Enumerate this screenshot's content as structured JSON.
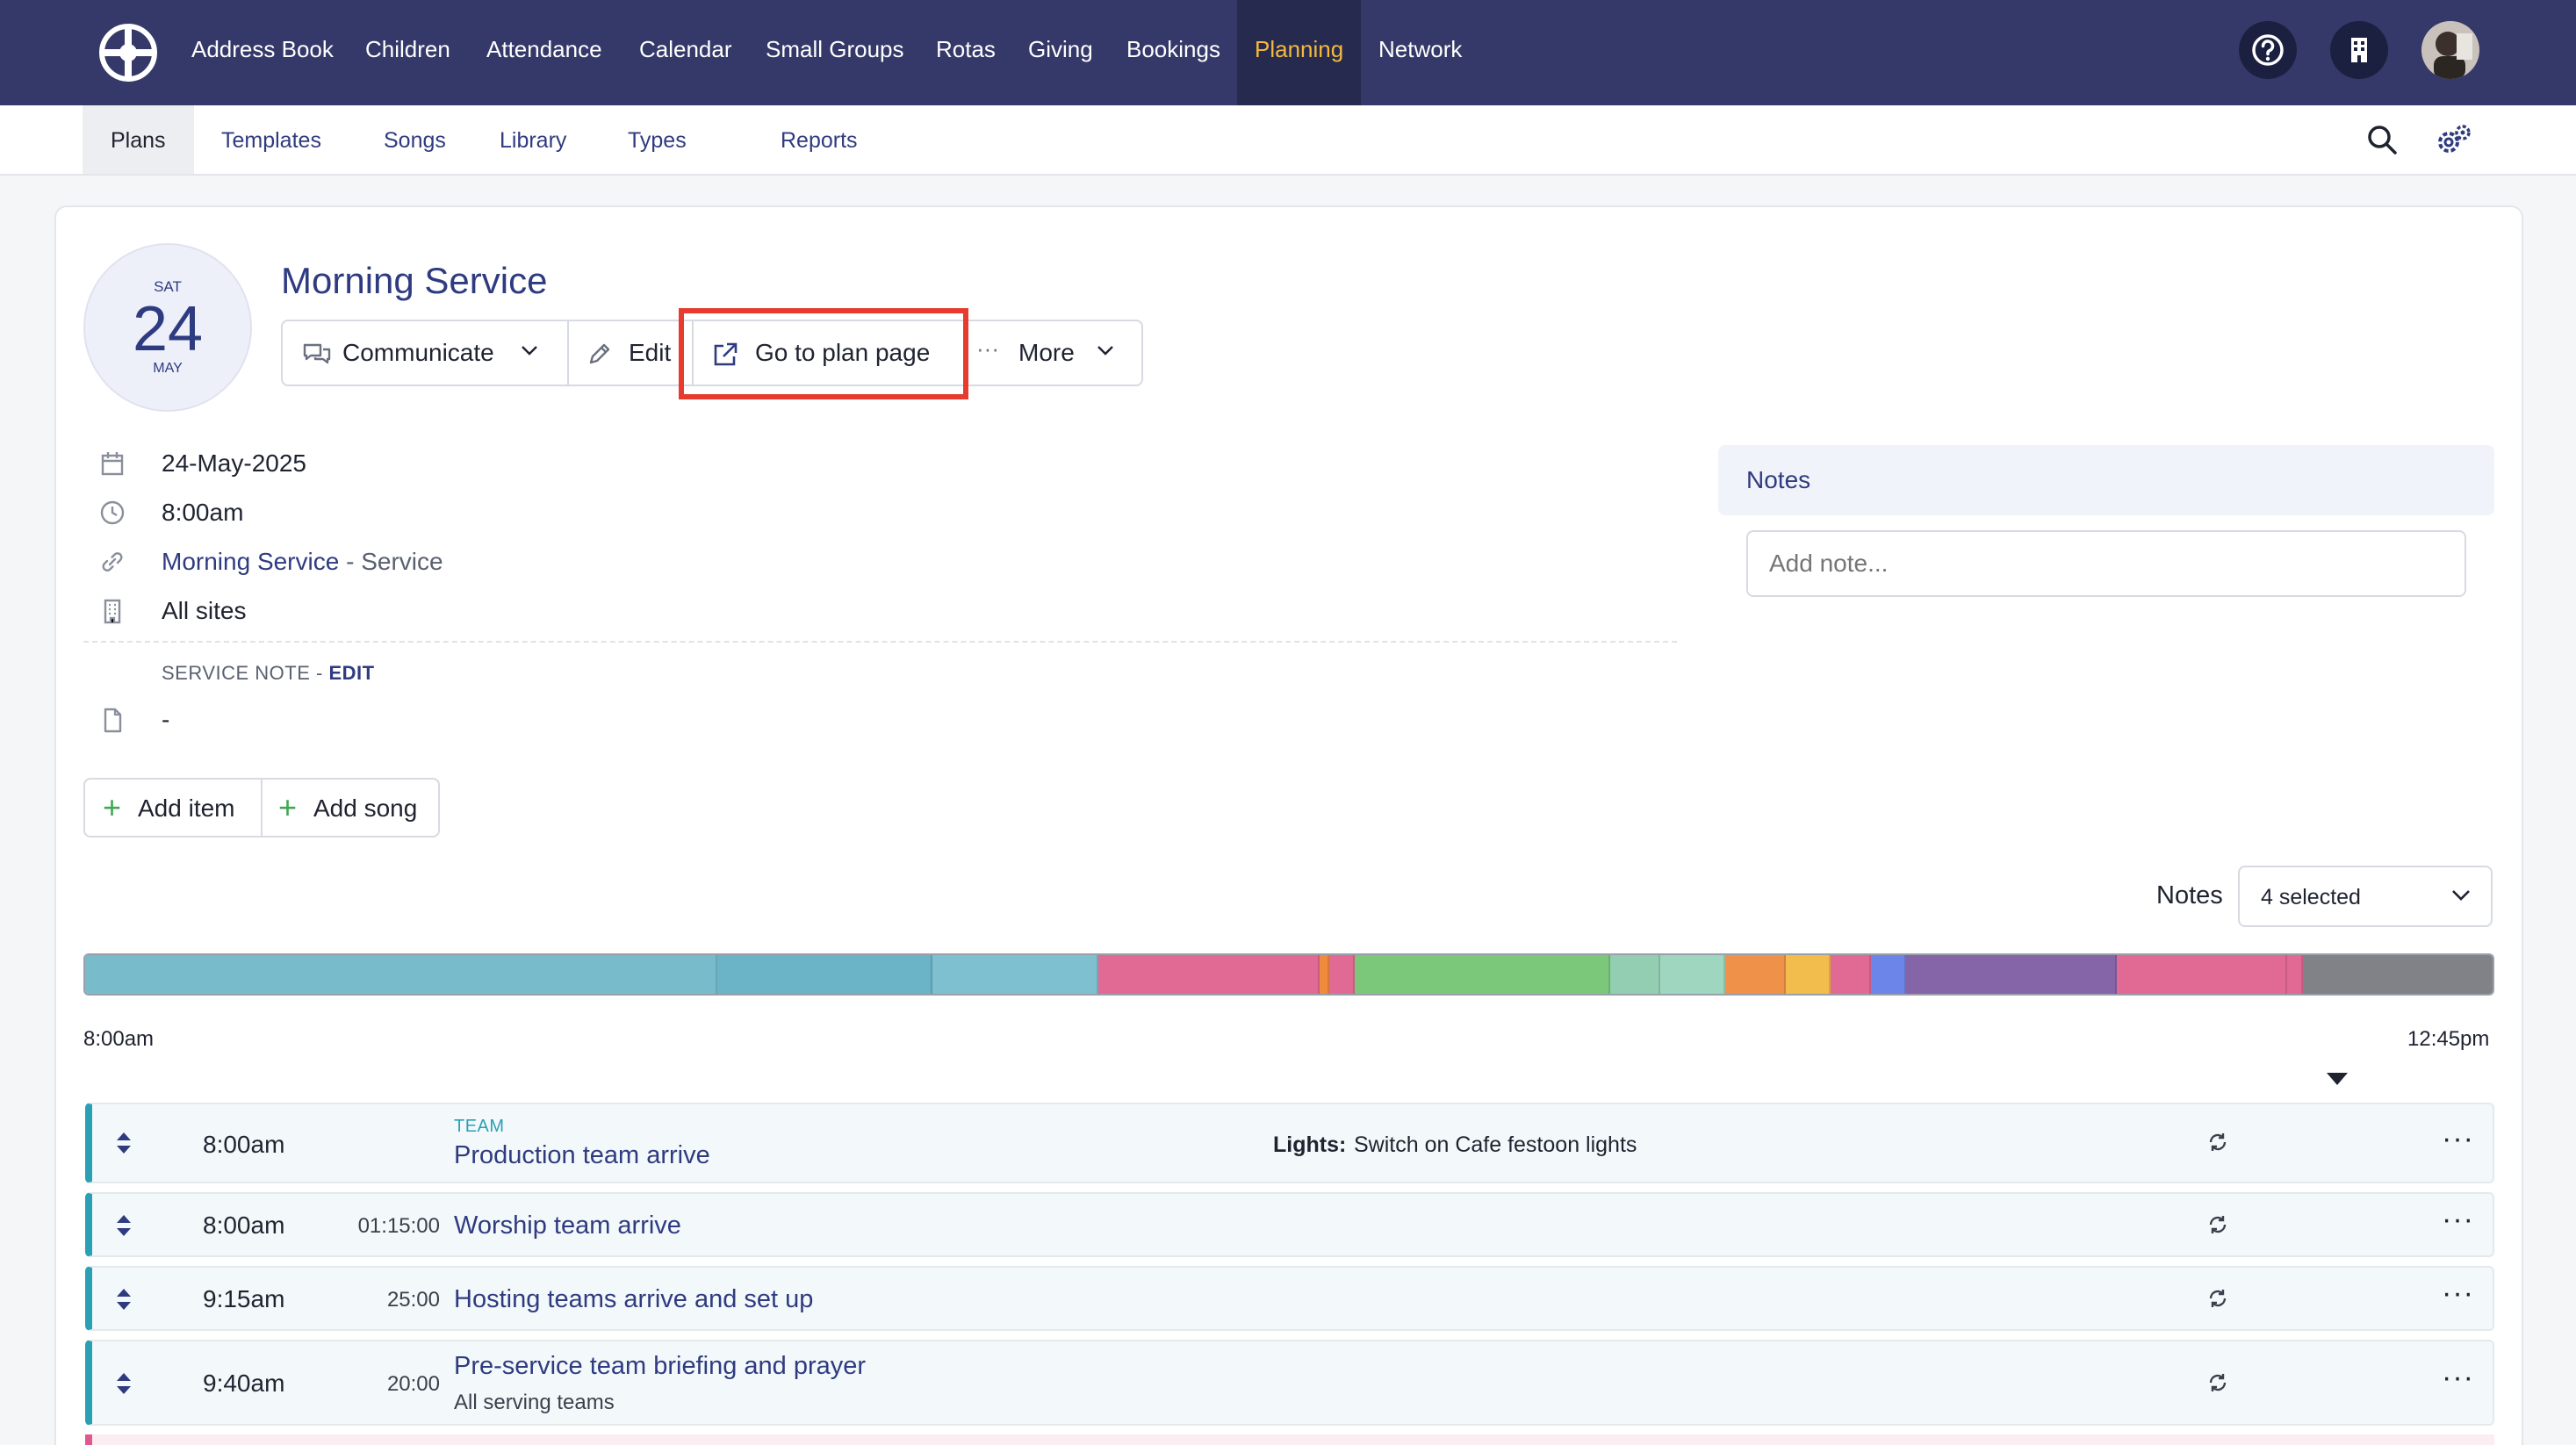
{
  "topnav": {
    "items": [
      "Address Book",
      "Children",
      "Attendance",
      "Calendar",
      "Small Groups",
      "Rotas",
      "Giving",
      "Bookings",
      "Planning",
      "Network"
    ],
    "active": "Planning",
    "icons": [
      "help-icon",
      "building-icon",
      "avatar"
    ]
  },
  "subnav": {
    "items": [
      "Plans",
      "Templates",
      "Songs",
      "Library",
      "Types",
      "Reports"
    ],
    "active": "Plans"
  },
  "plan": {
    "date_badge": {
      "dow": "SAT",
      "day": "24",
      "month": "MAY"
    },
    "title": "Morning Service",
    "actions": {
      "communicate": "Communicate",
      "edit": "Edit",
      "go_to_plan": "Go to plan page",
      "more": "More"
    },
    "date": "24-May-2025",
    "time": "8:00am",
    "service_link": "Morning Service",
    "service_suffix": " - Service",
    "sites": "All sites",
    "service_note_label": "SERVICE NOTE - ",
    "service_note_edit": "EDIT",
    "service_note_value": "-",
    "add_item": "Add item",
    "add_song": "Add song"
  },
  "notes_panel": {
    "title": "Notes",
    "placeholder": "Add note..."
  },
  "notes_filter": {
    "label": "Notes",
    "value": "4 selected"
  },
  "timeline": {
    "start": "8:00am",
    "end": "12:45pm",
    "segment_colors": [
      "#78bccb",
      "#6bb3c6",
      "#7ec0cf",
      "#e06a93",
      "#f08a3c",
      "#e06a93",
      "#7cc87a",
      "#93ceb3",
      "#9fd6bf",
      "#f0914a",
      "#f2bd4c",
      "#e06a93",
      "#6b86e8",
      "#8564a8",
      "#e06a93",
      "#e06a93",
      "#808287"
    ],
    "segment_fractions": [
      0.2625,
      0.0896,
      0.0688,
      0.0917,
      0.0042,
      0.0104,
      0.1063,
      0.0208,
      0.0271,
      0.025,
      0.0188,
      0.0167,
      0.0146,
      0.0875,
      0.0708,
      0.0063,
      0.0813
    ]
  },
  "items": [
    {
      "tag": "TEAM",
      "time": "8:00am",
      "duration": "",
      "title": "Production team arrive",
      "subtitle": "",
      "note_label": "Lights:",
      "note_text": "Switch on Cafe festoon lights"
    },
    {
      "tag": "",
      "time": "8:00am",
      "duration": "01:15:00",
      "title": "Worship team arrive",
      "subtitle": "",
      "note_label": "",
      "note_text": ""
    },
    {
      "tag": "",
      "time": "9:15am",
      "duration": "25:00",
      "title": "Hosting teams arrive and set up",
      "subtitle": "",
      "note_label": "",
      "note_text": ""
    },
    {
      "tag": "",
      "time": "9:40am",
      "duration": "20:00",
      "title": "Pre-service team briefing and prayer",
      "subtitle": "All serving teams",
      "note_label": "",
      "note_text": ""
    }
  ]
}
